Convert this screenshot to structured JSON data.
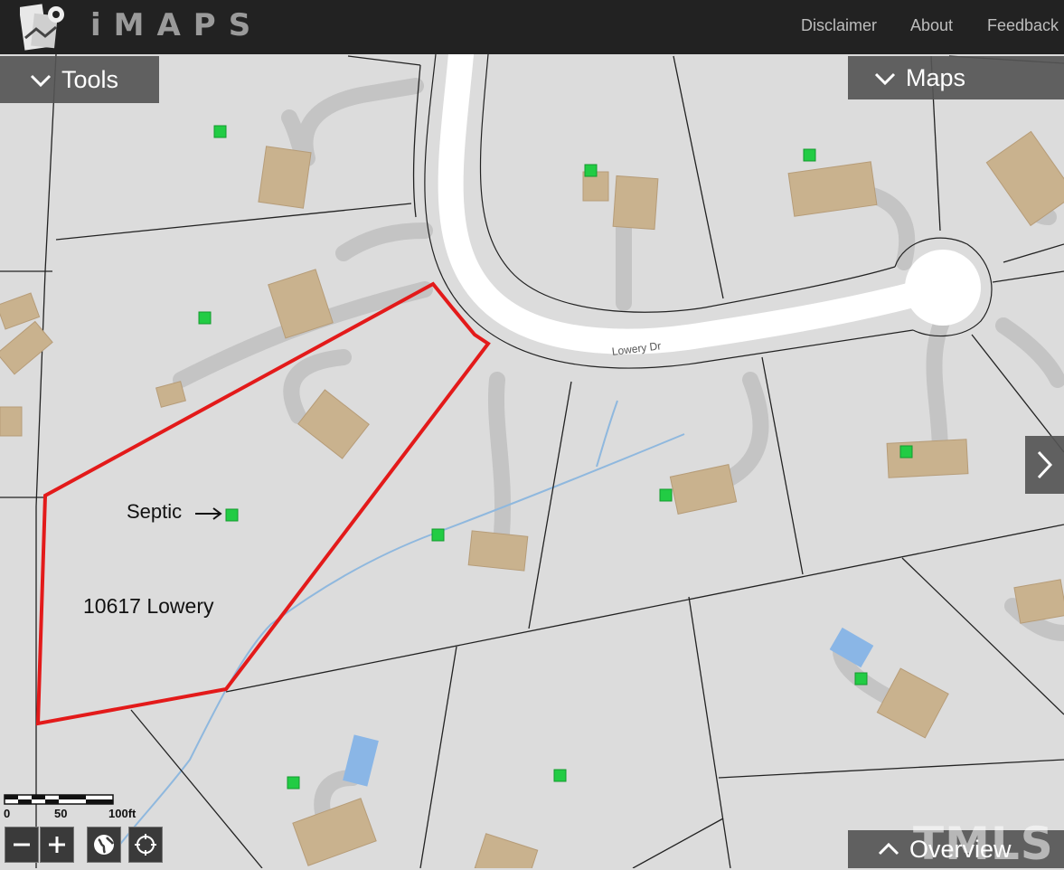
{
  "header": {
    "title": "iMAPS",
    "nav": [
      "Disclaimer",
      "About",
      "Feedback"
    ]
  },
  "panels": {
    "tools": "Tools",
    "maps": "Maps",
    "overview": "Overview"
  },
  "map": {
    "street_label": "Lowery Dr",
    "annotations": {
      "septic": "Septic",
      "address": "10617 Lowery"
    },
    "scale_labels": [
      "0",
      "50",
      "100ft"
    ],
    "colors": {
      "parcel_highlight": "#e31a1a",
      "marker": "#22cc44",
      "building": "#c9b28e",
      "driveway": "#c4c4c4",
      "stream": "#8fb8de",
      "pool": "#8ab6e6"
    }
  },
  "controls": [
    "zoom-out",
    "zoom-in",
    "globe",
    "locate"
  ],
  "watermark": "TMLS"
}
